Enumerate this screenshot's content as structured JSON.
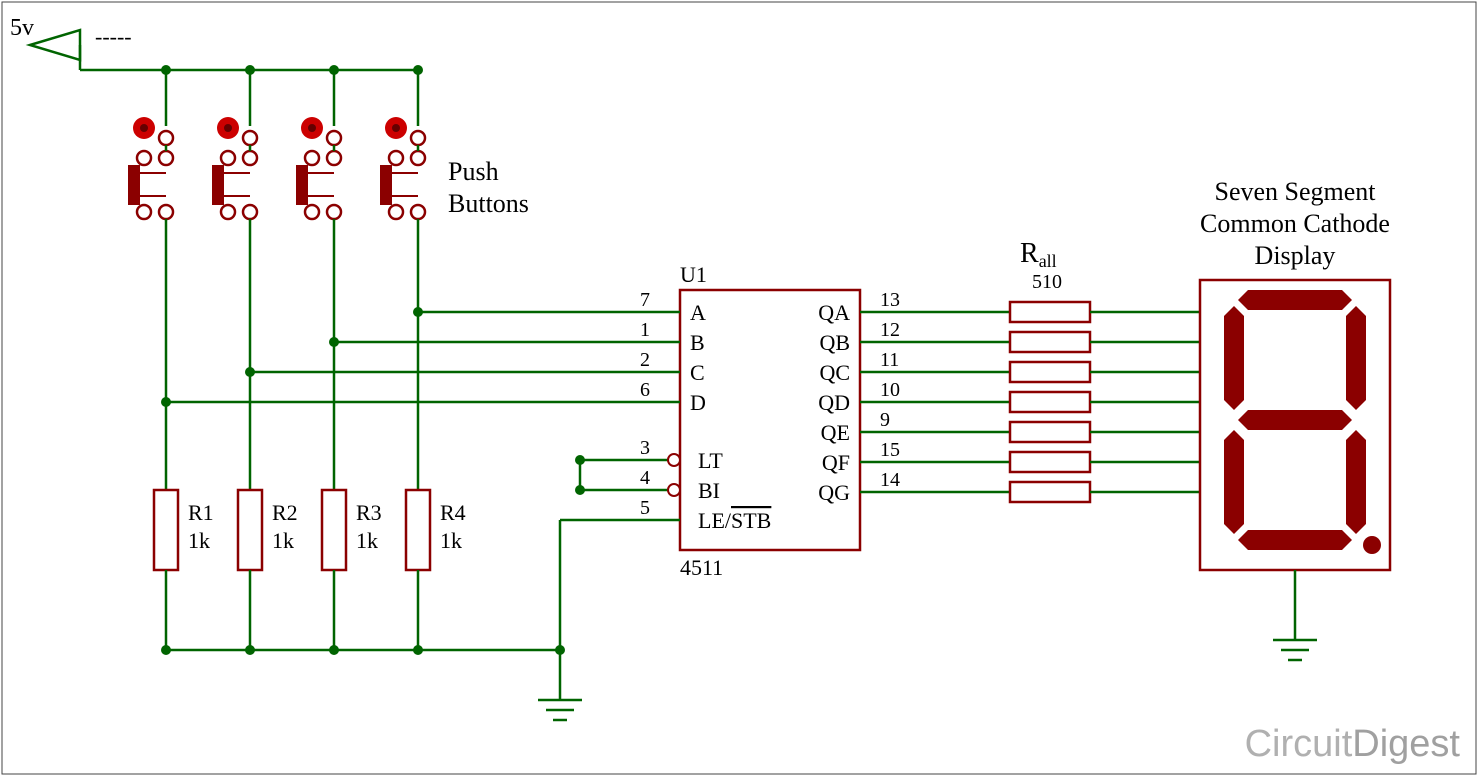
{
  "power": {
    "label": "5v",
    "dashes": "-----"
  },
  "buttons": {
    "label_line1": "Push",
    "label_line2": "Buttons"
  },
  "resistors_input": {
    "r1": {
      "name": "R1",
      "value": "1k"
    },
    "r2": {
      "name": "R2",
      "value": "1k"
    },
    "r3": {
      "name": "R3",
      "value": "1k"
    },
    "r4": {
      "name": "R4",
      "value": "1k"
    }
  },
  "ic": {
    "ref": "U1",
    "part": "4511",
    "pins_left": [
      {
        "num": "7",
        "name": "A"
      },
      {
        "num": "1",
        "name": "B"
      },
      {
        "num": "2",
        "name": "C"
      },
      {
        "num": "6",
        "name": "D"
      },
      {
        "num": "3",
        "name": "LT"
      },
      {
        "num": "4",
        "name": "BI"
      },
      {
        "num": "5",
        "name": "LE/STB"
      }
    ],
    "pins_right": [
      {
        "num": "13",
        "name": "QA"
      },
      {
        "num": "12",
        "name": "QB"
      },
      {
        "num": "11",
        "name": "QC"
      },
      {
        "num": "10",
        "name": "QD"
      },
      {
        "num": "9",
        "name": "QE"
      },
      {
        "num": "15",
        "name": "QF"
      },
      {
        "num": "14",
        "name": "QG"
      }
    ]
  },
  "resistor_array": {
    "name": "Rall",
    "value": "510",
    "sub": "all",
    "prefix": "R"
  },
  "display": {
    "line1": "Seven Segment",
    "line2": "Common Cathode",
    "line3": "Display"
  },
  "watermark": {
    "part1": "Circuit",
    "part2": "Digest"
  }
}
